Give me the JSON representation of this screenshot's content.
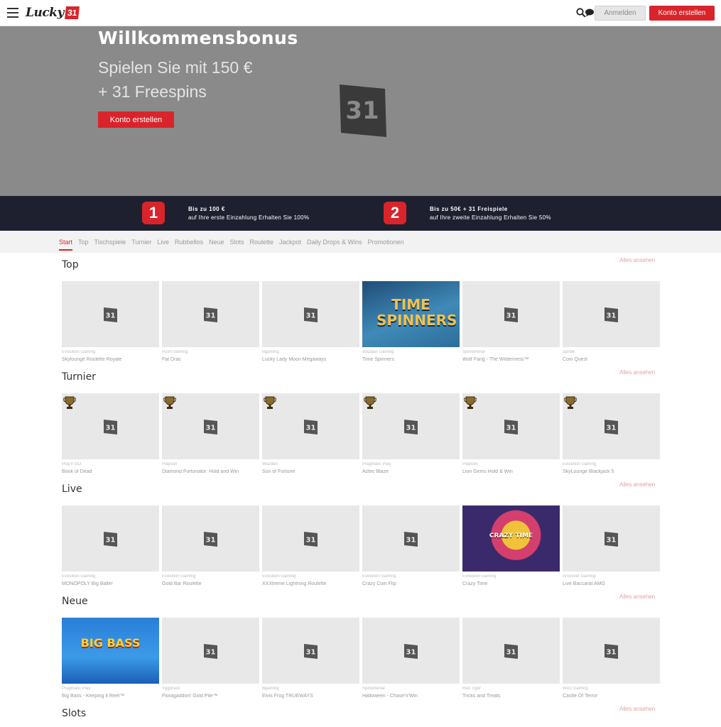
{
  "header": {
    "logo_text": "Lucky",
    "logo_badge": "31",
    "login_label": "Anmelden",
    "register_label": "Konto erstellen"
  },
  "hero": {
    "title": "Willkommensbonus",
    "line1": "Spielen Sie mit 150 €",
    "line2": "+ 31 Freespins",
    "cta_label": "Konto erstellen"
  },
  "steps": [
    {
      "num": "1",
      "title": "Bis zu 100 €",
      "sub": "auf Ihre erste Einzahlung Erhalten Sie 100%"
    },
    {
      "num": "2",
      "title": "Bis zu 50€ + 31 Freispiele",
      "sub": "auf Ihre zweite Einzahlung Erhalten Sie 50%"
    }
  ],
  "tabs": [
    "Start",
    "Top",
    "Tischspiele",
    "Turnier",
    "Live",
    "Rubbellos",
    "Neue",
    "Slots",
    "Roulette",
    "Jackpot",
    "Daily Drops & Wins",
    "Promotionen"
  ],
  "see_all": "Alles ansehen",
  "sections": [
    {
      "title": "Top",
      "games": [
        {
          "provider": "Evolution Gaming",
          "name": "Skylounge Roulette Royale"
        },
        {
          "provider": "Push Gaming",
          "name": "Fat Drac"
        },
        {
          "provider": "Bgaming",
          "name": "Lucky Lady Moon Megaways"
        },
        {
          "provider": "Wazdan Gaming",
          "name": "Time Spinners",
          "art": "time",
          "art_text": "TIME SPINNERS"
        },
        {
          "provider": "Spinomenal",
          "name": "Wolf Fang - The Wilderness™"
        },
        {
          "provider": "Spribe",
          "name": "Coin Quest"
        }
      ]
    },
    {
      "title": "Turnier",
      "games": [
        {
          "provider": "Play'n GO",
          "name": "Book of Dead",
          "trophy": true
        },
        {
          "provider": "Playson",
          "name": "Diamond Fortunator: Hold and Win",
          "trophy": true
        },
        {
          "provider": "Wazdan",
          "name": "Sun of Fortune",
          "trophy": true
        },
        {
          "provider": "Pragmatic Play",
          "name": "Aztec Blaze",
          "trophy": true
        },
        {
          "provider": "Playson",
          "name": "Lion Gems Hold & Win",
          "trophy": true
        },
        {
          "provider": "Evolution Gaming",
          "name": "SkyLounge Blackjack 5",
          "trophy": true
        }
      ]
    },
    {
      "title": "Live",
      "games": [
        {
          "provider": "Evolution Gaming",
          "name": "MONOPOLY Big Baller"
        },
        {
          "provider": "Evolution Gaming",
          "name": "Gold Bar Roulette"
        },
        {
          "provider": "Evolution Gaming",
          "name": "XXXtreme Lightning Roulette"
        },
        {
          "provider": "Evolution Gaming",
          "name": "Crazy Coin Flip"
        },
        {
          "provider": "Evolution Gaming",
          "name": "Crazy Time",
          "art": "crazy",
          "art_text": "CRAZY TIME"
        },
        {
          "provider": "Amusnet Gaming",
          "name": "Live Baccarat AMG"
        }
      ]
    },
    {
      "title": "Neue",
      "games": [
        {
          "provider": "Pragmatic Play",
          "name": "Big Bass - Keeping it Reel™",
          "art": "bass",
          "art_text": "BIG BASS"
        },
        {
          "provider": "Yggdrasil",
          "name": "Floragaddon! Gold Pile™"
        },
        {
          "provider": "Bgaming",
          "name": "Elvis Frog TRUEWAYS"
        },
        {
          "provider": "Spinomenal",
          "name": "Halloween - Chase'n'Win"
        },
        {
          "provider": "Red Tiger",
          "name": "Tricks and Treats"
        },
        {
          "provider": "Wizz Gaming",
          "name": "Castle Of Terror"
        }
      ]
    },
    {
      "title": "Slots",
      "games": []
    }
  ]
}
